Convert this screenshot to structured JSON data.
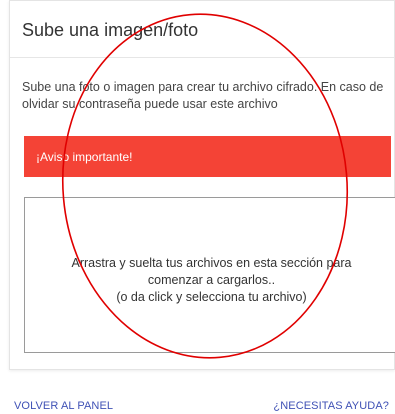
{
  "card": {
    "title": "Sube una imagen/foto",
    "description": "Sube una foto o imagen para crear tu archivo cifrado. En caso de olvidar su contraseña puede usar este archivo"
  },
  "alert": {
    "text": "¡Aviso importante!",
    "color": "#f44336"
  },
  "dropzone": {
    "line1": "Arrastra y suelta tus archivos en esta sección para",
    "line2": "comenzar a cargarlos..",
    "line3": "(o da click y selecciona tu archivo)"
  },
  "footer": {
    "back_label": "VOLVER AL PANEL",
    "help_label": "¿NECESITAS AYUDA?",
    "link_color": "#3f51b5"
  },
  "annotation": {
    "shape": "ellipse",
    "color": "#e00000"
  }
}
